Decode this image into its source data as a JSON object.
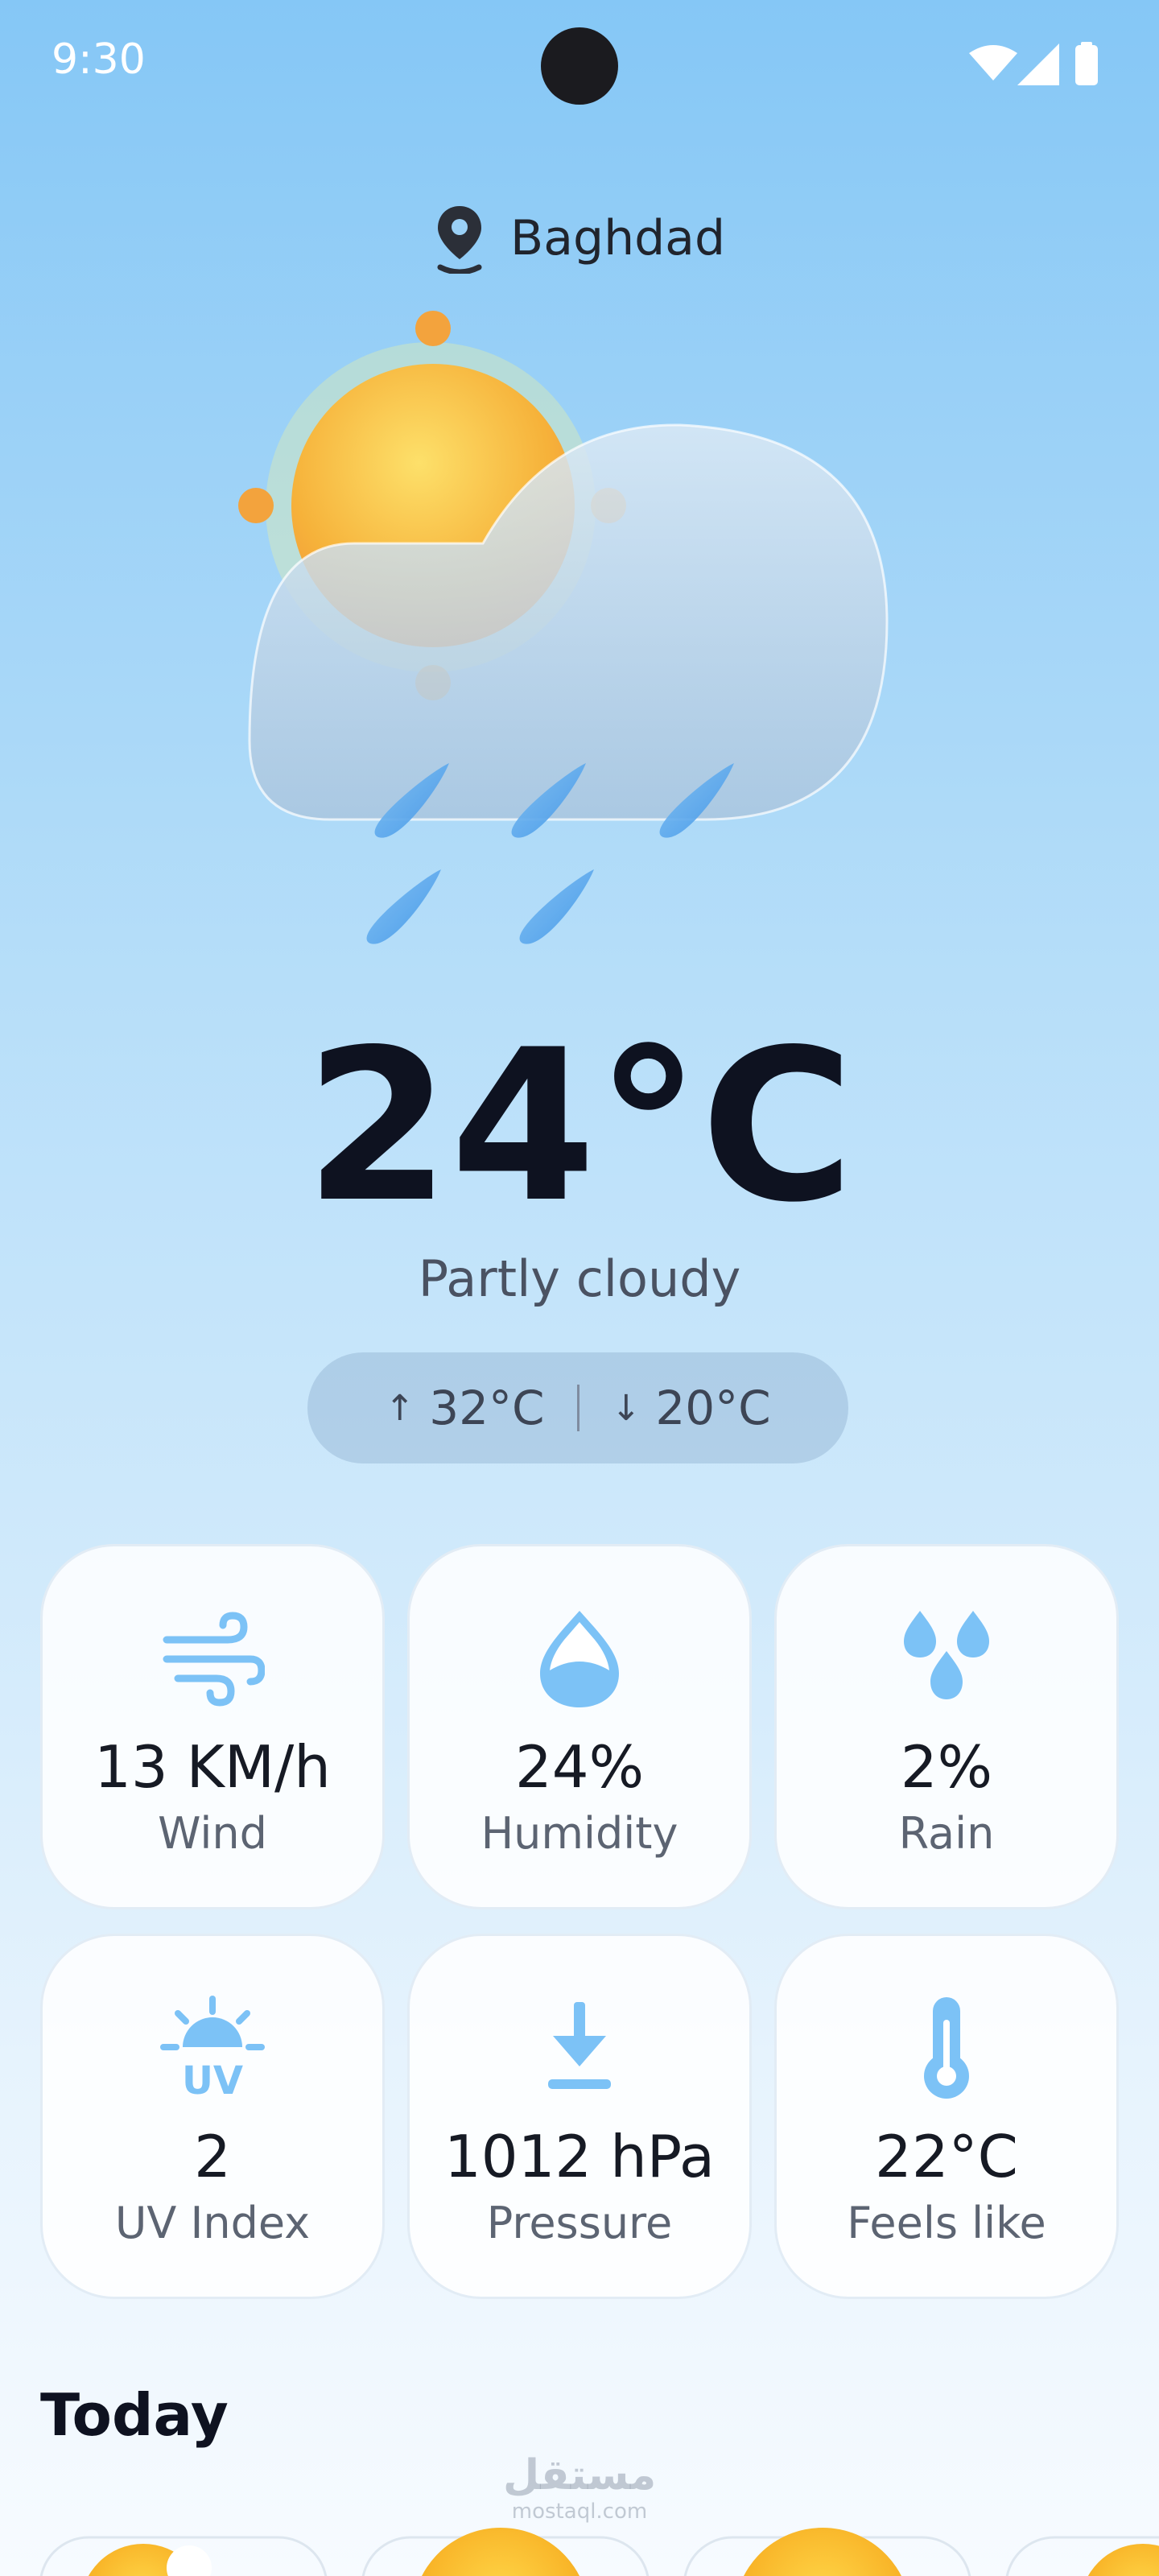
{
  "status_bar": {
    "time": "9:30",
    "icons": [
      "wifi-icon",
      "signal-icon",
      "battery-icon"
    ]
  },
  "location": {
    "icon": "location-pin-icon",
    "city": "Baghdad"
  },
  "current": {
    "illustration": "sun-cloud-rain-icon",
    "temperature": "24°C",
    "condition": "Partly cloudy",
    "high": "32°C",
    "low": "20°C"
  },
  "stats": [
    {
      "icon": "wind-icon",
      "value": "13 KM/h",
      "label": "Wind"
    },
    {
      "icon": "humidity-drop-icon",
      "value": "24%",
      "label": "Humidity"
    },
    {
      "icon": "rain-drops-icon",
      "value": "2%",
      "label": "Rain"
    },
    {
      "icon": "uv-sun-icon",
      "value": "2",
      "label": "UV Index"
    },
    {
      "icon": "pressure-arrow-icon",
      "value": "1012 hPa",
      "label": "Pressure"
    },
    {
      "icon": "thermometer-icon",
      "value": "22°C",
      "label": "Feels like"
    }
  ],
  "today": {
    "title": "Today"
  },
  "watermark": {
    "arabic": "مستقل",
    "latin": "mostaql.com"
  },
  "colors": {
    "accent": "#7cc2f6",
    "sun": "#f5b028",
    "text_primary": "#0e1220"
  }
}
